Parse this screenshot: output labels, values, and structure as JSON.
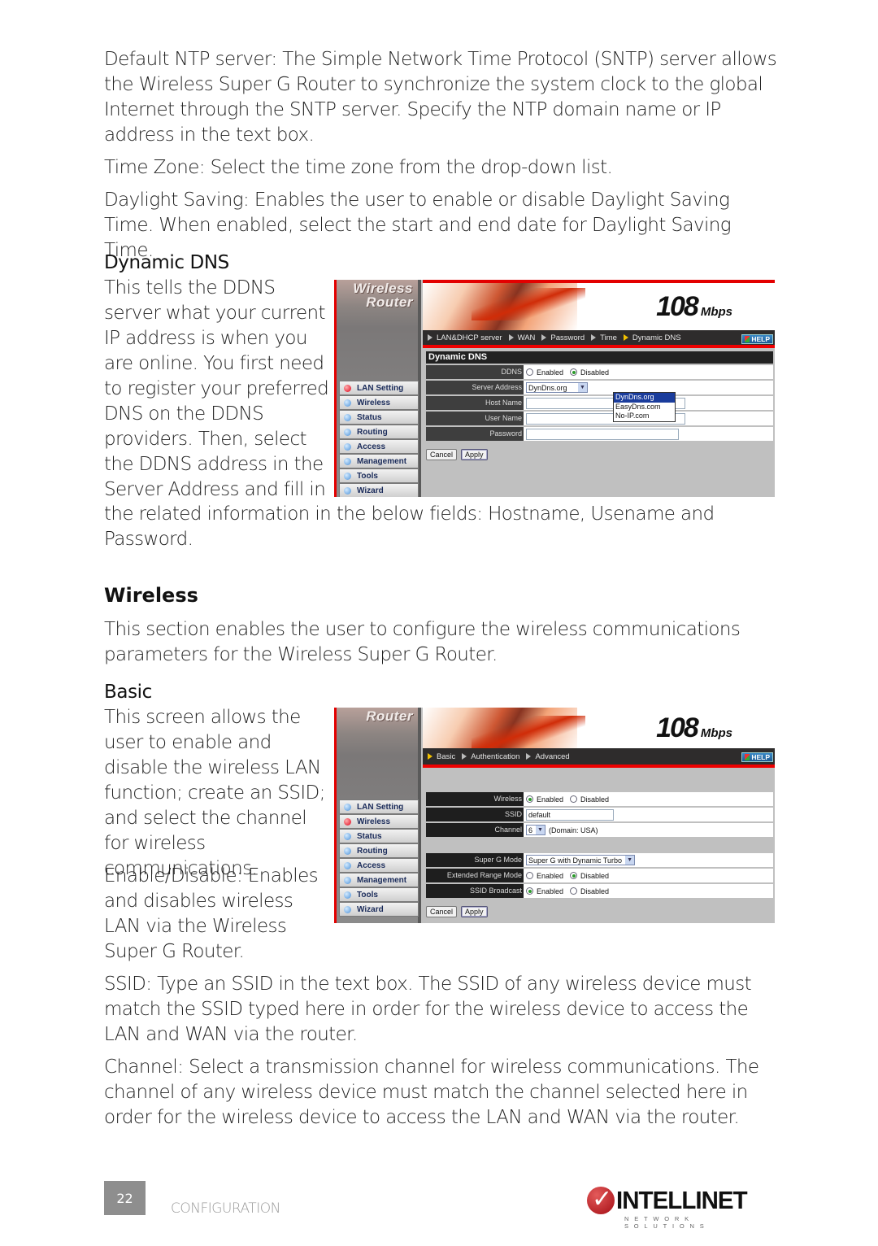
{
  "text": {
    "ntp": "Default NTP server: The Simple Network Time Protocol (SNTP) server allows the Wireless Super G Router to synchronize the system clock to the global Internet through the SNTP server. Specify the NTP domain name or IP address in the text box.",
    "time_zone": "Time Zone: Select the time zone from the drop-down list.",
    "daylight_saving": "Daylight Saving: Enables the user to enable or disable Daylight Saving Time. When enabled, select the start and end date for Daylight Saving Time.",
    "ddns_heading": "Dynamic DNS",
    "ddns_side": "This tells the DDNS server what your current IP address is when you are online. You first need to register your preferred DNS on the DDNS providers. Then, select the DDNS address in the Server Address and fill in",
    "ddns_cont": "the related information in the below fields: Hostname, Usename and Password.",
    "wireless_heading": "Wireless",
    "wireless_intro": "This section enables the user to configure the wireless communications parameters for the Wireless Super G Router.",
    "basic_heading": "Basic",
    "basic_side": "This screen allows the user to enable and disable the wireless LAN function; create an SSID; and select the channel for wireless communications.",
    "enable_side": "Enable/Disable: Enables and disables wireless LAN via the Wireless Super G Router.",
    "ssid": "SSID: Type an SSID in the text box. The SSID of any wireless device must match the SSID typed here in order for the wireless device to access the LAN and WAN via the router.",
    "channel": "Channel: Select a transmission channel for wireless communications. The channel of any wireless device must match the channel selected here in order for the wireless device to access the LAN and WAN via the router."
  },
  "router_common": {
    "speed": "108",
    "speed_unit": "Mbps",
    "help_label": "HELP",
    "nav": [
      "LAN Setting",
      "Wireless",
      "Status",
      "Routing",
      "Access",
      "Management",
      "Tools",
      "Wizard"
    ],
    "cancel_label": "Cancel",
    "apply_label": "Apply",
    "enabled_label": "Enabled",
    "disabled_label": "Disabled"
  },
  "shot1": {
    "logo_line1": "Wireless",
    "logo_line2": "Router",
    "active_nav": "LAN Setting",
    "tabs": [
      "LAN&DHCP server",
      "WAN",
      "Password",
      "Time",
      "Dynamic DNS"
    ],
    "active_tab": "Dynamic DNS",
    "section_title": "Dynamic DNS",
    "fields": {
      "ddns_label": "DDNS",
      "ddns_value": "Disabled",
      "server_address_label": "Server Address",
      "server_address_value": "DynDns.org",
      "host_name_label": "Host Name",
      "user_name_label": "User Name",
      "password_label": "Password"
    },
    "dropdown_options": [
      "DynDns.org",
      "EasyDns.com",
      "No-IP.com"
    ],
    "dropdown_highlighted": "DynDns.org"
  },
  "shot2": {
    "logo_line1": "Router",
    "active_nav": "Wireless",
    "tabs": [
      "Basic",
      "Authentication",
      "Advanced"
    ],
    "active_tab": "Basic",
    "fields": {
      "wireless_label": "Wireless",
      "wireless_value": "Enabled",
      "ssid_label": "SSID",
      "ssid_value": "default",
      "channel_label": "Channel",
      "channel_value": "6",
      "channel_domain": "(Domain: USA)",
      "super_g_label": "Super G Mode",
      "super_g_value": "Super G with Dynamic Turbo",
      "ext_range_label": "Extended Range Mode",
      "ext_range_value": "Disabled",
      "ssid_broadcast_label": "SSID Broadcast",
      "ssid_broadcast_value": "Enabled"
    }
  },
  "footer": {
    "page_number": "22",
    "section": "CONFIGURATION",
    "brand": "INTELLINET",
    "brand_sub": "NETWORK SOLUTIONS"
  },
  "colors": {
    "accent_red": "#e30000",
    "router_dark": "#2e2c2c",
    "page_badge": "#8e8e8e"
  }
}
